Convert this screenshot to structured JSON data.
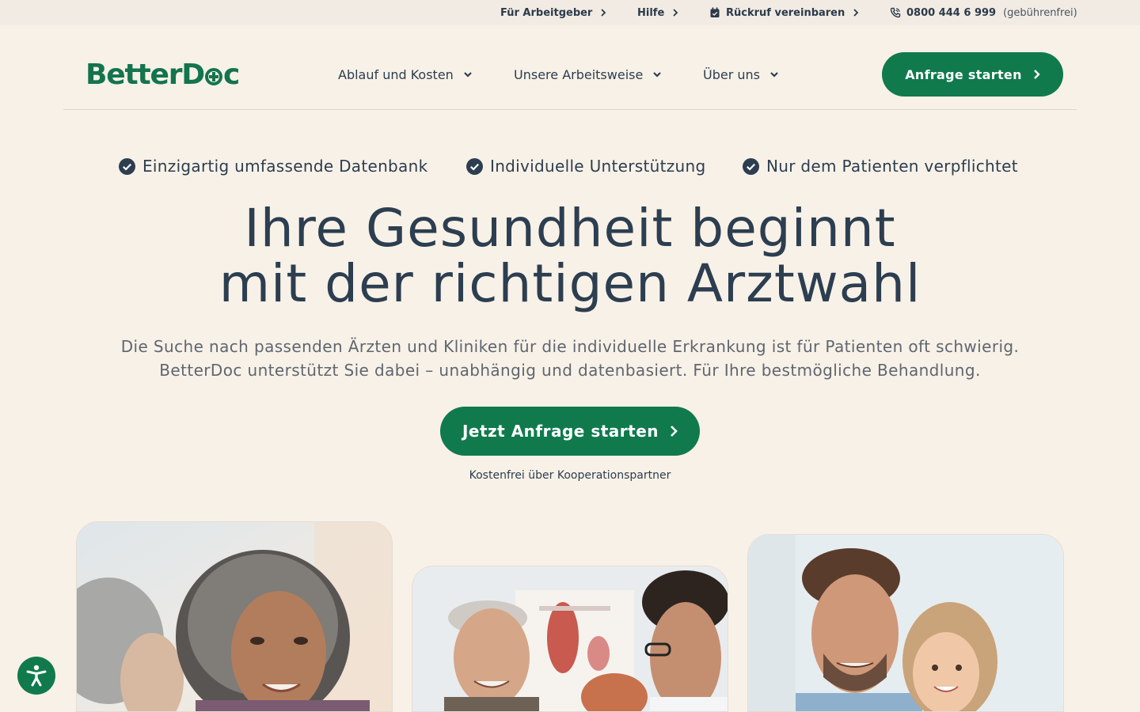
{
  "topbar": {
    "employers": "Für Arbeitgeber",
    "help": "Hilfe",
    "callback": "Rückruf vereinbaren",
    "phone": "0800 444 6 999",
    "phone_note": "(gebührenfrei)"
  },
  "header": {
    "logo_prefix": "BetterD",
    "logo_suffix": "c",
    "nav": {
      "process": "Ablauf und Kosten",
      "approach": "Unsere Arbeitsweise",
      "about": "Über uns"
    },
    "cta": "Anfrage starten"
  },
  "features": [
    "Einzigartig umfassende Datenbank",
    "Individuelle Unterstützung",
    "Nur dem Patienten verpflichtet"
  ],
  "hero": {
    "title_line1": "Ihre Gesundheit beginnt",
    "title_line2": "mit der richtigen Arztwahl",
    "subtitle_line1": "Die Suche nach passenden Ärzten und Kliniken für die individuelle Erkrankung ist für Patienten oft schwierig.",
    "subtitle_line2": "BetterDoc unterstützt Sie dabei – unabhängig und datenbasiert. Für Ihre bestmögliche Behandlung.",
    "cta": "Jetzt Anfrage starten",
    "cta_note": "Kostenfrei über Kooperationspartner"
  },
  "icons": {
    "topbar_chevron": "chevron-right-icon",
    "calendar": "calendar-icon",
    "phone": "phone-icon",
    "nav_chevron": "chevron-down-icon",
    "check": "check-circle-icon",
    "accessibility": "accessibility-icon"
  },
  "colors": {
    "brand_green": "#107a4d",
    "background": "#f8f1e7",
    "topbar_background": "#f1ebe3",
    "text": "#2c3e50"
  }
}
